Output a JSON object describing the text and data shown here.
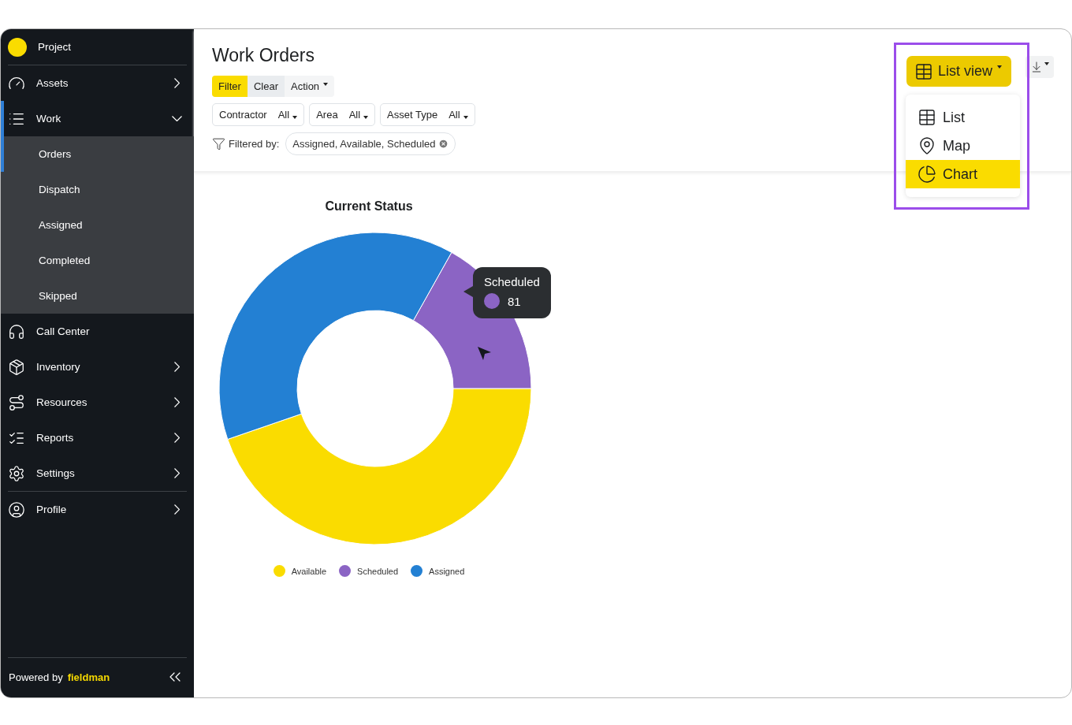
{
  "sidebar": {
    "project": {
      "label": "Project",
      "color": "#fadc00"
    },
    "items": [
      {
        "label": "Assets",
        "kind": "group",
        "expanded": false,
        "selected": false
      },
      {
        "label": "Work",
        "kind": "group",
        "expanded": true,
        "selected": true,
        "children": [
          {
            "label": "Orders",
            "selected": true
          },
          {
            "label": "Dispatch",
            "selected": false
          },
          {
            "label": "Assigned",
            "selected": false
          },
          {
            "label": "Completed",
            "selected": false
          },
          {
            "label": "Skipped",
            "selected": false
          }
        ]
      },
      {
        "label": "Call Center",
        "kind": "link",
        "selected": false
      },
      {
        "label": "Inventory",
        "kind": "group",
        "expanded": false,
        "selected": false
      },
      {
        "label": "Resources",
        "kind": "group",
        "expanded": false,
        "selected": false
      },
      {
        "label": "Reports",
        "kind": "group",
        "expanded": false,
        "selected": false
      },
      {
        "label": "Settings",
        "kind": "group",
        "expanded": false,
        "selected": false
      }
    ],
    "profile": {
      "label": "Profile",
      "expanded": false,
      "selected": false
    },
    "footer": {
      "powered_by": "Powered by",
      "brand": "fieldman"
    }
  },
  "main": {
    "title": "Work Orders",
    "actions": [
      {
        "label": "Filter",
        "kind": "primary"
      },
      {
        "label": "Clear",
        "kind": "plain"
      },
      {
        "label": "Action",
        "kind": "dropdown"
      }
    ],
    "filters": [
      {
        "label": "Contractor",
        "value": "All"
      },
      {
        "label": "Area",
        "value": "All"
      },
      {
        "label": "Asset Type",
        "value": "All"
      }
    ],
    "filtered_by": {
      "label": "Filtered by:",
      "chip": "Assigned, Available, Scheduled"
    },
    "view_menu": {
      "button": "List view",
      "open": true,
      "highlighted": true,
      "items": [
        {
          "label": "List",
          "selected": false
        },
        {
          "label": "Map",
          "selected": false
        },
        {
          "label": "Chart",
          "selected": true
        }
      ]
    },
    "chart": {
      "title": "Current Status",
      "legend": [
        {
          "label": "Available",
          "color": "#fadc00"
        },
        {
          "label": "Scheduled",
          "color": "#8b64c4"
        },
        {
          "label": "Assigned",
          "color": "#2380d3"
        }
      ],
      "tooltip": {
        "series": "Scheduled",
        "value": "81",
        "color": "#8b64c4"
      }
    }
  }
}
